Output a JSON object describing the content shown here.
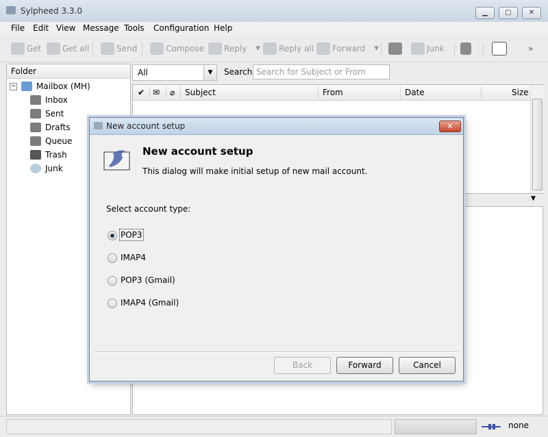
{
  "window": {
    "title": "Sylpheed 3.3.0"
  },
  "menu": [
    "File",
    "Edit",
    "View",
    "Message",
    "Tools",
    "Configuration",
    "Help"
  ],
  "toolbar": {
    "get": "Get",
    "get_all": "Get all",
    "send": "Send",
    "compose": "Compose",
    "reply": "Reply",
    "reply_all": "Reply all",
    "forward": "Forward",
    "junk": "Junk",
    "more": "»"
  },
  "folder_pane": {
    "header": "Folder",
    "root": "Mailbox (MH)",
    "folders": [
      "Inbox",
      "Sent",
      "Drafts",
      "Queue",
      "Trash",
      "Junk"
    ]
  },
  "filter": {
    "selected": "All",
    "search_label": "Search:",
    "search_placeholder": "Search for Subject or From"
  },
  "message_list": {
    "columns": [
      "Subject",
      "From",
      "Date",
      "Size"
    ]
  },
  "status": {
    "network": "none"
  },
  "dialog": {
    "title": "New account setup",
    "heading": "New account setup",
    "description": "This dialog will make initial setup of new mail account.",
    "select_label": "Select account type:",
    "options": [
      "POP3",
      "IMAP4",
      "POP3 (Gmail)",
      "IMAP4 (Gmail)"
    ],
    "selected_index": 0,
    "buttons": {
      "back": "Back",
      "forward": "Forward",
      "cancel": "Cancel"
    }
  },
  "colors": {
    "dialog_border": "#6e8299",
    "close_button": "#c8452c"
  }
}
